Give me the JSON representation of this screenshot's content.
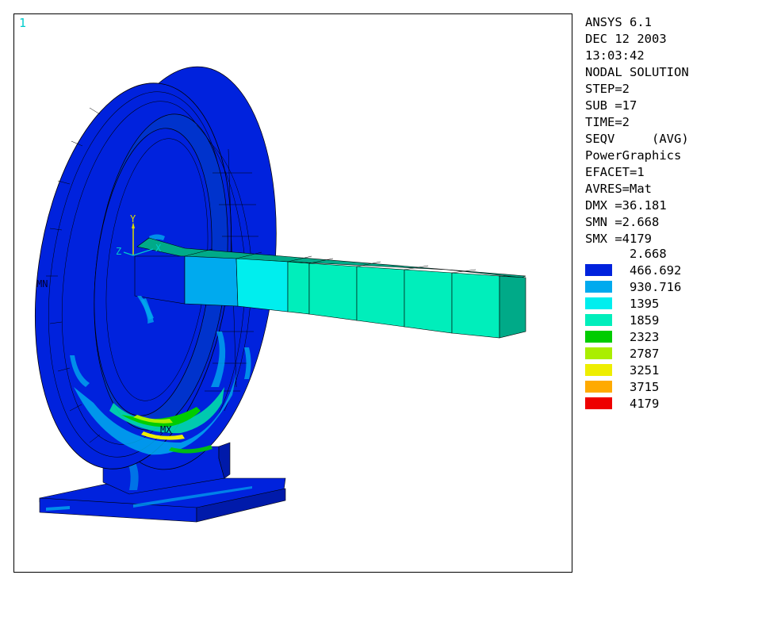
{
  "window": {
    "number": "1"
  },
  "info": {
    "lines": [
      "ANSYS 6.1",
      "DEC 12 2003",
      "13:03:42",
      "NODAL SOLUTION",
      "STEP=2",
      "SUB =17",
      "TIME=2",
      "SEQV     (AVG)",
      "PowerGraphics",
      "EFACET=1",
      "AVRES=Mat",
      "DMX =36.181",
      "SMN =2.668",
      "SMX =4179"
    ]
  },
  "legend": {
    "min_label": "2.668",
    "items": [
      {
        "label": "466.692",
        "color": "#0022dd"
      },
      {
        "label": "930.716",
        "color": "#00aaee"
      },
      {
        "label": "1395",
        "color": "#00eeee"
      },
      {
        "label": "1859",
        "color": "#00eebb"
      },
      {
        "label": "2323",
        "color": "#00cc00"
      },
      {
        "label": "2787",
        "color": "#aaee00"
      },
      {
        "label": "3251",
        "color": "#eeee00"
      },
      {
        "label": "3715",
        "color": "#ffaa00"
      },
      {
        "label": "4179",
        "color": "#ee0000"
      }
    ]
  },
  "model": {
    "axis_labels": {
      "y": "Y",
      "z": "Z",
      "x": "X"
    },
    "markers": {
      "min": "MN",
      "max": "MX"
    },
    "colors": {
      "base_blue": "#0022dd",
      "dark_blue": "#001aaa",
      "mid_blue": "#0033cc",
      "cyan": "#00aaee",
      "light_cyan": "#00eeee",
      "teal": "#00ddaa",
      "dark_teal": "#00aa88",
      "green": "#00cc00",
      "yellow_green": "#aaee00",
      "yellow": "#eeee00",
      "axis_yellow": "#dddd00"
    }
  }
}
